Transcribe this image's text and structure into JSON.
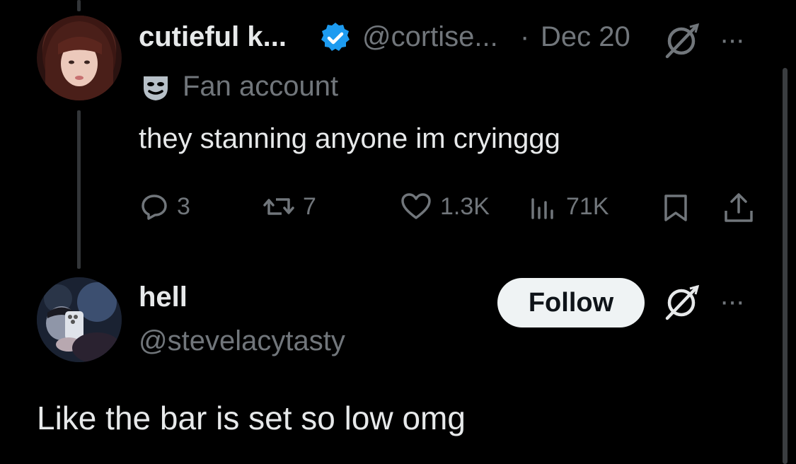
{
  "tweet": {
    "author_name": "cutieful k...",
    "handle": "@cortise...",
    "separator": "·",
    "date": "Dec 20",
    "account_label": "Fan account",
    "text": "they stanning anyone im cryinggg",
    "more": "···",
    "stats": {
      "replies": "3",
      "reposts": "7",
      "likes": "1.3K",
      "views": "71K"
    },
    "icons": {
      "verified": "verified-badge-icon",
      "grok": "grok-icon",
      "fan": "theater-mask-icon",
      "reply": "reply-icon",
      "repost": "repost-icon",
      "like": "heart-icon",
      "views": "views-icon",
      "bookmark": "bookmark-icon",
      "share": "share-icon"
    }
  },
  "reply": {
    "author_name": "hell",
    "handle": "@stevelacytasty",
    "follow_label": "Follow",
    "more": "···",
    "text": "Like the bar is set so low omg"
  },
  "colors": {
    "background": "#000000",
    "primary_text": "#e7e9ea",
    "secondary_text": "#71767b",
    "verified_blue": "#1d9bf0",
    "follow_button_bg": "#eff3f4",
    "thread_line": "#333639"
  }
}
